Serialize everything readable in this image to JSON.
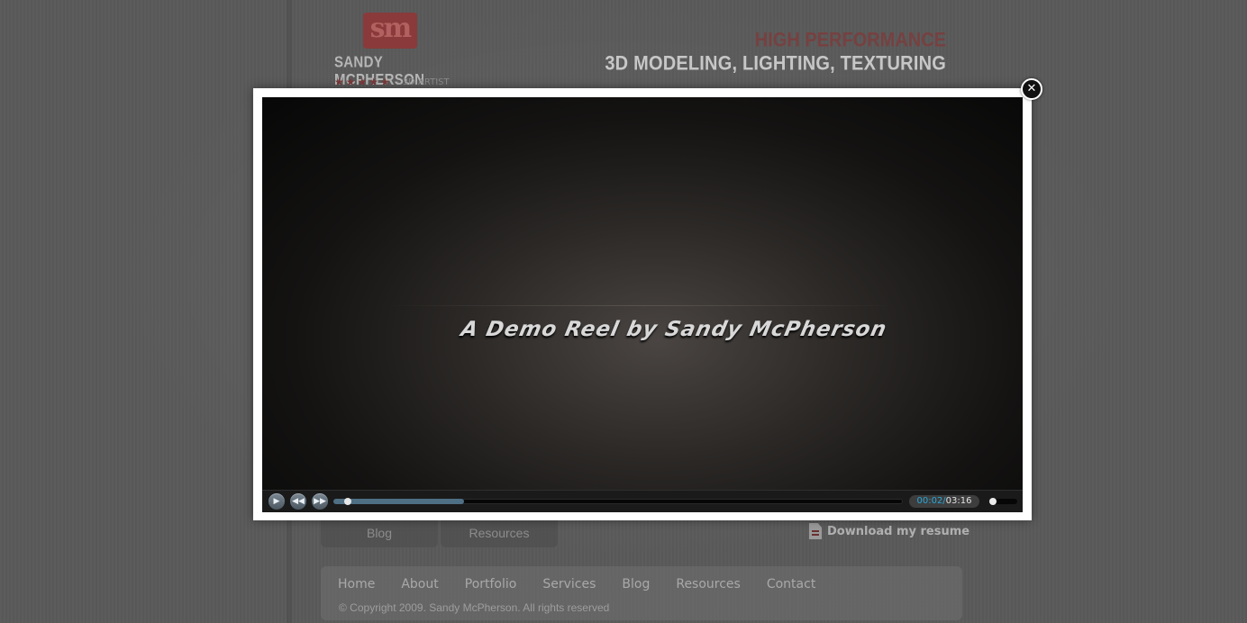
{
  "header": {
    "logo_text": "sm",
    "site_name": "SANDY MCPHERSON",
    "stars": "★★★★★",
    "subtitle": "- 3D ARTIST",
    "tagline_line1": "HIGH PERFORMANCE",
    "tagline_line2": "3D MODELING, LIGHTING, TEXTURING"
  },
  "tabs": [
    {
      "label": "Blog"
    },
    {
      "label": "Resources"
    }
  ],
  "resume_link": "Download my resume",
  "footer": {
    "nav": [
      "Home",
      "About",
      "Portfolio",
      "Services",
      "Blog",
      "Resources",
      "Contact"
    ],
    "copyright": "© Copyright 2009. Sandy McPherson. All rights reserved"
  },
  "modal": {
    "video_title": "A Demo Reel by Sandy McPherson",
    "player": {
      "current_time": "00:02/",
      "total_time": "03:16",
      "buffered_fraction": 0.23,
      "played_fraction": 0.01,
      "volume_fraction": 0.0,
      "icons": {
        "play": "play-icon",
        "rewind": "rewind-icon",
        "fast_forward": "fast-forward-icon"
      }
    },
    "close_glyph": "✕"
  },
  "colors": {
    "accent_time": "#2aa7d6",
    "brand_red": "#8a3a3a"
  }
}
